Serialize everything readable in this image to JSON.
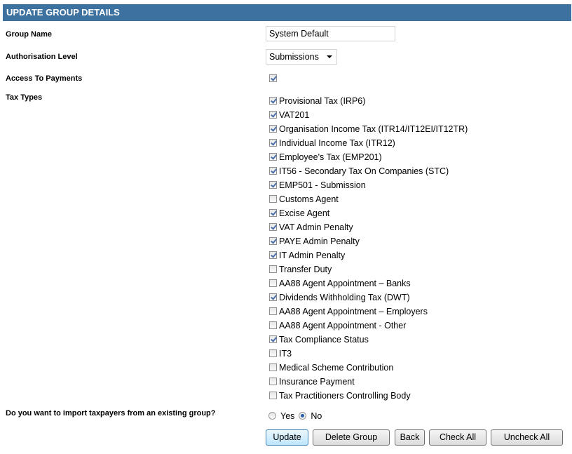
{
  "header": {
    "title": "UPDATE GROUP DETAILS"
  },
  "form": {
    "group_name": {
      "label": "Group Name",
      "value": "System Default"
    },
    "authorisation_level": {
      "label": "Authorisation Level",
      "selected": "Submissions"
    },
    "access_to_payments": {
      "label": "Access To Payments",
      "checked": true
    },
    "tax_types": {
      "label": "Tax Types",
      "items": [
        {
          "label": "Provisional Tax (IRP6)",
          "checked": true
        },
        {
          "label": "VAT201",
          "checked": true
        },
        {
          "label": "Organisation Income Tax (ITR14/IT12EI/IT12TR)",
          "checked": true
        },
        {
          "label": "Individual Income Tax (ITR12)",
          "checked": true
        },
        {
          "label": "Employee's Tax (EMP201)",
          "checked": true
        },
        {
          "label": "IT56 - Secondary Tax On Companies (STC)",
          "checked": true
        },
        {
          "label": "EMP501 - Submission",
          "checked": true
        },
        {
          "label": "Customs Agent",
          "checked": false
        },
        {
          "label": "Excise Agent",
          "checked": true
        },
        {
          "label": "VAT Admin Penalty",
          "checked": true
        },
        {
          "label": "PAYE Admin Penalty",
          "checked": true
        },
        {
          "label": "IT Admin Penalty",
          "checked": true
        },
        {
          "label": "Transfer Duty",
          "checked": false
        },
        {
          "label": "AA88 Agent Appointment – Banks",
          "checked": false
        },
        {
          "label": "Dividends Withholding Tax (DWT)",
          "checked": true
        },
        {
          "label": "AA88 Agent Appointment – Employers",
          "checked": false
        },
        {
          "label": "AA88 Agent Appointment - Other",
          "checked": false
        },
        {
          "label": "Tax Compliance Status",
          "checked": true
        },
        {
          "label": "IT3",
          "checked": false
        },
        {
          "label": "Medical Scheme Contribution",
          "checked": false
        },
        {
          "label": "Insurance Payment",
          "checked": false
        },
        {
          "label": "Tax Practitioners Controlling Body",
          "checked": false
        }
      ]
    },
    "import_question": {
      "label": "Do you want to import taxpayers from an existing group?",
      "options": [
        {
          "label": "Yes",
          "checked": false
        },
        {
          "label": "No",
          "checked": true
        }
      ]
    }
  },
  "buttons": {
    "update": "Update",
    "delete_group": "Delete Group",
    "back": "Back",
    "check_all": "Check All",
    "uncheck_all": "Uncheck All"
  }
}
